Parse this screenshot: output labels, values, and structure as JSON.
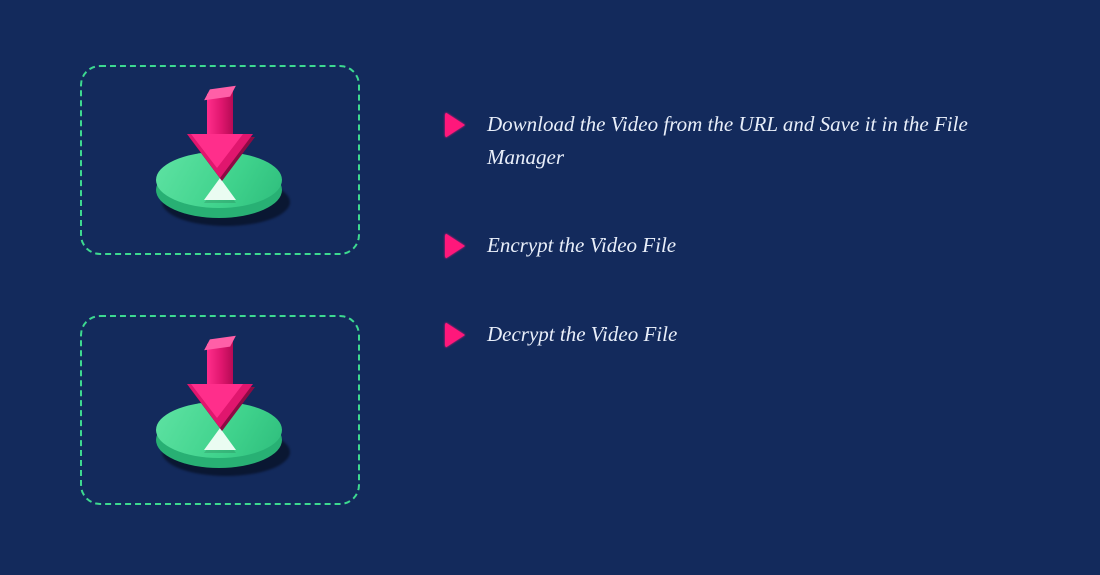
{
  "steps": [
    {
      "label": "Download the Video from the URL and Save it in the File Manager"
    },
    {
      "label": "Encrypt the Video File"
    },
    {
      "label": "Decrypt the Video File"
    }
  ],
  "icons": {
    "card": "download-to-disc-icon",
    "bullet": "play-triangle-icon"
  },
  "colors": {
    "background": "#132a5c",
    "card_border": "#3dd990",
    "disc_top": "#3fd28c",
    "disc_rim": "#28b074",
    "arrow": "#ff2e8b",
    "bullet": "#ff177b",
    "text": "#e8eef9"
  }
}
